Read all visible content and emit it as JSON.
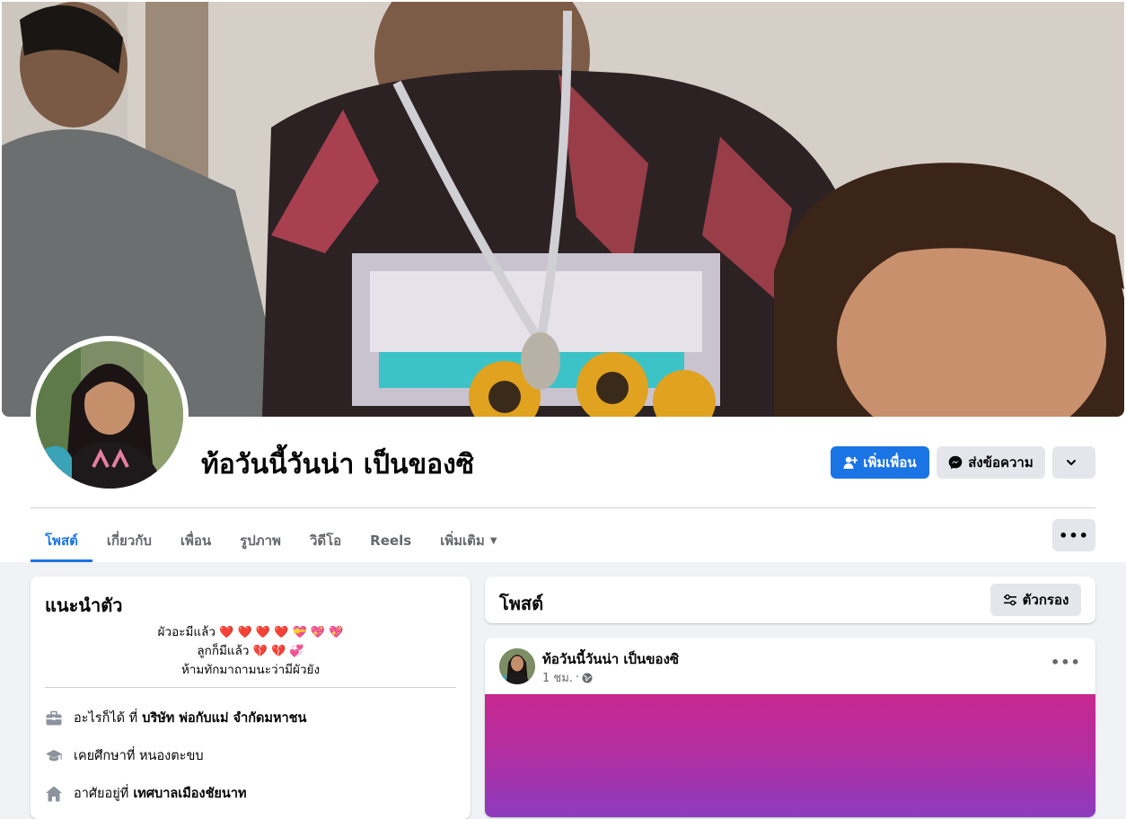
{
  "profile": {
    "name": "ท้อวันนี้วันน่า เป็นของซิ"
  },
  "actions": {
    "add_friend": "เพิ่มเพื่อน",
    "message": "ส่งข้อความ"
  },
  "tabs": [
    {
      "label": "โพสต์",
      "active": true
    },
    {
      "label": "เกี่ยวกับ",
      "active": false
    },
    {
      "label": "เพื่อน",
      "active": false
    },
    {
      "label": "รูปภาพ",
      "active": false
    },
    {
      "label": "วิดีโอ",
      "active": false
    },
    {
      "label": "Reels",
      "active": false
    },
    {
      "label": "เพิ่มเติม",
      "active": false
    }
  ],
  "intro": {
    "title": "แนะนำตัว",
    "bio": [
      {
        "text": "ผัวอะมีแล้ว",
        "emoji": "❤️ ❤️ ❤️ ❤️ 💝 💖 💖"
      },
      {
        "text": "ลูกก็มีแล้ว",
        "emoji": "💔 💔 💞"
      },
      {
        "text": "ห้ามทักมาถามนะว่ามีผัวยัง",
        "emoji": ""
      }
    ],
    "details": [
      {
        "icon": "briefcase-icon",
        "prefix": "อะไรก็ได้ ที่",
        "value": "บริษัท พ่อกับแม่ จำกัดมหาชน"
      },
      {
        "icon": "graduation-cap-icon",
        "prefix": "เคยศึกษาที่ หนองตะขบ",
        "value": ""
      },
      {
        "icon": "home-icon",
        "prefix": "อาศัยอยู่ที่",
        "value": "เทศบาลเมืองชัยนาท"
      }
    ]
  },
  "posts": {
    "title": "โพสต์",
    "filter_label": "ตัวกรอง"
  },
  "post": {
    "author": "ท้อวันนี้วันน่า เป็นของซิ",
    "time": "1 ชม.",
    "separator": "·",
    "background_color": "#c8288e"
  },
  "colors": {
    "accent": "#1b74e4",
    "page_bg": "#f0f2f5"
  }
}
